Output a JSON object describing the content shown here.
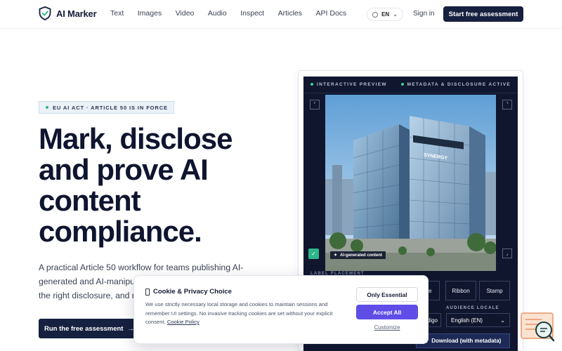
{
  "header": {
    "brand": "AI Marker",
    "nav": [
      "Text",
      "Images",
      "Video",
      "Audio",
      "Inspect",
      "Articles",
      "API Docs"
    ],
    "language": "EN",
    "signin": "Sign in",
    "cta": "Start free assessment"
  },
  "hero": {
    "badge": "EU AI ACT · ARTICLE 50 IS IN FORCE",
    "title": "Mark, disclose and prove AI content compliance.",
    "description_lines": [
      "A practical Article 50 workflow for teams publishing AI-",
      "generated and AI-manipula",
      "the right disclosure, and re"
    ],
    "cta": "Run the free assessment",
    "cta_arrow": "→"
  },
  "preview": {
    "left_label": "INTERACTIVE PREVIEW",
    "right_label": "METADATA & DISCLOSURE ACTIVE",
    "ai_tag": "AI-generated content",
    "building_sign": "SYNERGY",
    "label_placement": "LABEL PLACEMENT",
    "placement_options": [
      "me",
      "Ribbon",
      "Stamp"
    ],
    "audience_locale_label": "AUDIENCE LOCALE",
    "audience_locale_value": "English (EN)",
    "style_value": "digo",
    "download": "Download (with metadata)"
  },
  "cookie": {
    "title": "Cookie & Privacy Choice",
    "text": "We use strictly necessary local storage and cookies to maintain sessions and remember UI settings. No invasive tracking cookies are set without your explicit consent.",
    "link": "Cookie Policy",
    "essential": "Only Essential",
    "accept": "Accept All",
    "customize": "Customize"
  },
  "colors": {
    "navy": "#16203f",
    "accent_purple": "#5e4de6",
    "status_green": "#2fb58a",
    "card_bg": "#10162e"
  }
}
